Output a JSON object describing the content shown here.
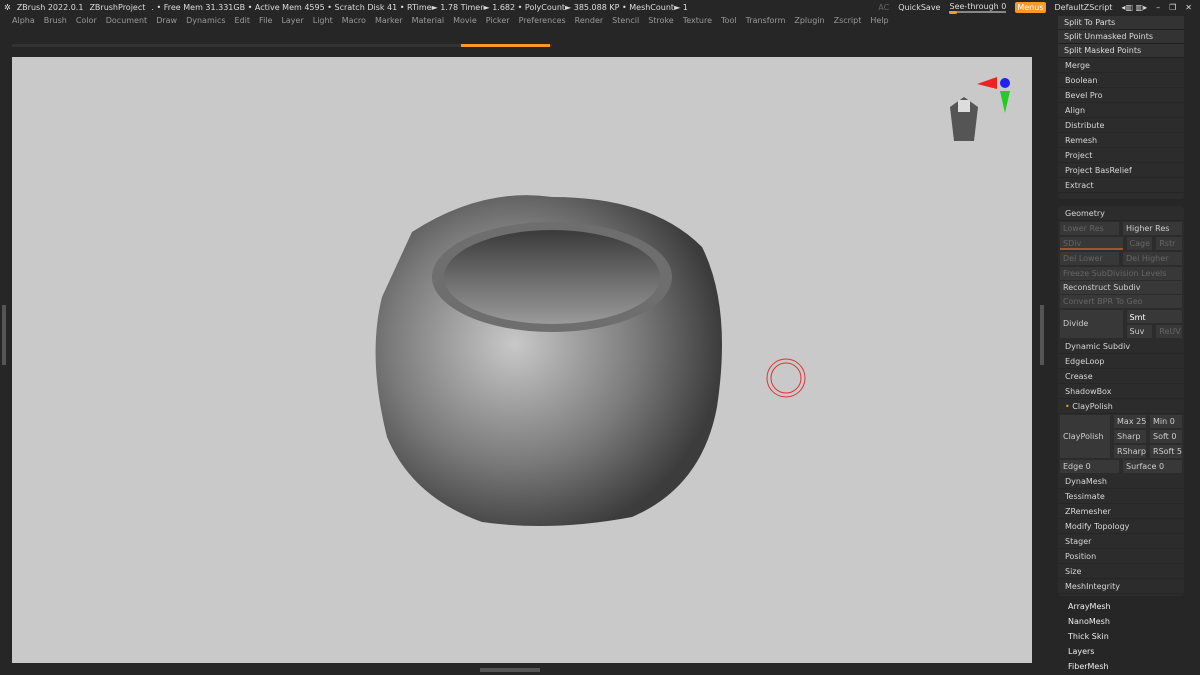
{
  "titlebar": {
    "app": "ZBrush 2022.0.1",
    "project": "ZBrushProject",
    "stats": ". • Free Mem 31.331GB • Active Mem 4595 • Scratch Disk 41 • RTime► 1.78 Timer► 1.682 • PolyCount► 385.088 KP • MeshCount► 1",
    "ac": "AC",
    "quicksave": "QuickSave",
    "seethrough": "See-through  0",
    "menus": "Menus",
    "defaultzscript": "DefaultZScript"
  },
  "menu": [
    "Alpha",
    "Brush",
    "Color",
    "Document",
    "Draw",
    "Dynamics",
    "Edit",
    "File",
    "Layer",
    "Light",
    "Macro",
    "Marker",
    "Material",
    "Movie",
    "Picker",
    "Preferences",
    "Render",
    "Stencil",
    "Stroke",
    "Texture",
    "Tool",
    "Transform",
    "Zplugin",
    "Zscript",
    "Help"
  ],
  "subtool": [
    "Split To Parts",
    "Split Unmasked Points",
    "Split Masked Points",
    "Merge",
    "Boolean",
    "Bevel Pro",
    "Align",
    "Distribute",
    "Remesh",
    "Project",
    "Project BasRelief",
    "Extract"
  ],
  "geometry": {
    "title": "Geometry",
    "lower_res": "Lower Res",
    "higher_res": "Higher Res",
    "sdiv": "SDiv",
    "cage": "Cage",
    "rstr": "Rstr",
    "del_lower": "Del Lower",
    "del_higher": "Del Higher",
    "freeze": "Freeze SubDivision Levels",
    "reconstruct": "Reconstruct Subdiv",
    "convert": "Convert BPR To Geo",
    "divide": "Divide",
    "smt": "Smt",
    "suv": "Suv",
    "reuv": "ReUV",
    "items1": [
      "Dynamic Subdiv",
      "EdgeLoop",
      "Crease",
      "ShadowBox"
    ],
    "claypolish": "ClayPolish",
    "max": "Max 25",
    "min": "Min 0",
    "sharp": "Sharp",
    "soft": "Soft 0",
    "rsharp": "RSharp",
    "rsoft": "RSoft 5",
    "edge": "Edge 0",
    "surface": "Surface 0",
    "items2": [
      "DynaMesh",
      "Tessimate",
      "ZRemesher",
      "Modify Topology",
      "Stager",
      "Position",
      "Size",
      "MeshIntegrity"
    ]
  },
  "tool_sections": [
    "ArrayMesh",
    "NanoMesh",
    "Thick Skin",
    "Layers",
    "FiberMesh"
  ],
  "colors": {
    "accent": "#f39a2a",
    "viewport": "#c9c9c9"
  }
}
